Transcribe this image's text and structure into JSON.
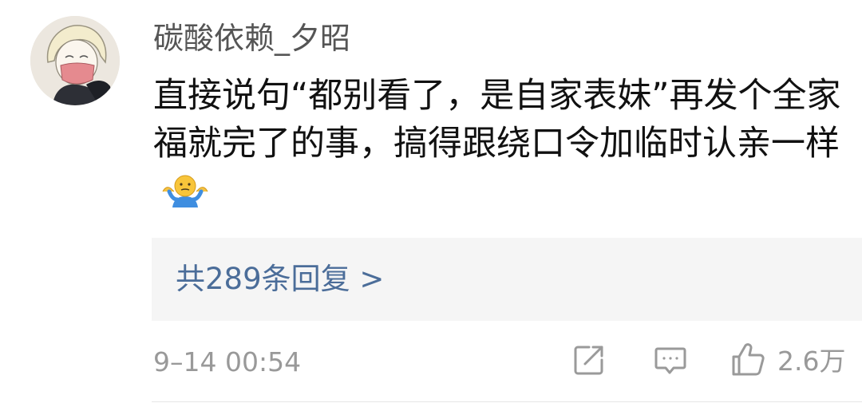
{
  "comment": {
    "username": "碳酸依赖_夕昭",
    "text": "直接说句“都别看了，是自家表妹”再发个全家福就完了的事，搞得跟绕口令加临时认亲一样",
    "emoji": "person-shrugging-emoji",
    "replies_label": "共289条回复 >",
    "timestamp": "9–14 00:54",
    "like_count": "2.6万"
  },
  "icons": {
    "share": "share-icon",
    "reply": "comment-icon",
    "like": "thumbs-up-icon"
  },
  "colors": {
    "link": "#4b6d99",
    "muted": "#999999",
    "text": "#111111",
    "username": "#555555",
    "reply_box_bg": "#f5f5f5"
  }
}
